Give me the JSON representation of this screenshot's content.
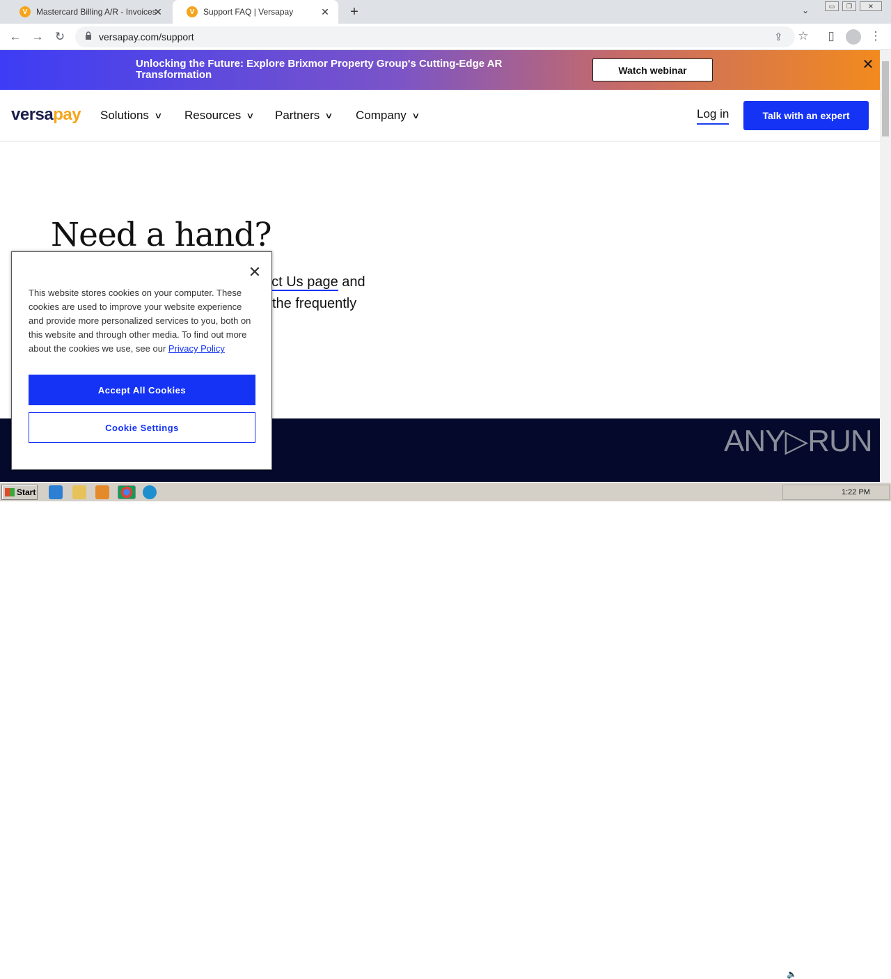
{
  "browser": {
    "tabs": [
      {
        "title": "Mastercard Billing A/R - Invoices",
        "favicon": "V",
        "active": false
      },
      {
        "title": "Support FAQ | Versapay",
        "favicon": "V",
        "active": true
      }
    ],
    "url": "versapay.com/support"
  },
  "banner": {
    "text": "Unlocking the Future: Explore Brixmor Property Group's Cutting-Edge AR Transformation",
    "button": "Watch webinar",
    "close": "✕"
  },
  "nav": {
    "logo_main": "versa",
    "logo_accent": "pay",
    "items": [
      "Solutions",
      "Resources",
      "Partners",
      "Company"
    ],
    "login": "Log in",
    "cta": "Talk with an expert"
  },
  "hero": {
    "title": "Need a hand?",
    "line1_link": "act Us page",
    "line1_tail": " and",
    "line2": "the frequently"
  },
  "cookie": {
    "text": "This website stores cookies on your computer. These cookies are used to improve your website experience and provide more personalized services to you, both on this website and through other media. To find out more about the cookies we use, see our ",
    "privacy_link": "Privacy Policy",
    "accept": "Accept All Cookies",
    "settings": "Cookie Settings",
    "close": "✕"
  },
  "watermark": "ANY▷RUN",
  "taskbar": {
    "start": "Start",
    "clock": "1:22 PM"
  },
  "colors": {
    "brand_blue": "#1533f5",
    "brand_orange": "#f5a51b",
    "footer_navy": "#050a2c"
  }
}
